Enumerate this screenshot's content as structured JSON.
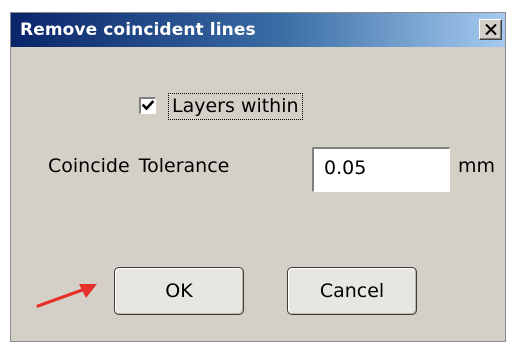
{
  "dialog": {
    "title": "Remove coincident lines",
    "close_glyph": "X",
    "layers_within": {
      "label": "Layers within",
      "checked": true
    },
    "tolerance": {
      "label": "Coincide Tolerance",
      "value": "0.05",
      "unit": "mm"
    },
    "buttons": {
      "ok_label": "OK",
      "cancel_label": "Cancel"
    }
  },
  "annotation": {
    "arrow_color": "#e8302a"
  },
  "colors": {
    "title_bar_start": "#0a246a",
    "title_bar_end": "#a6caf0",
    "dialog_face": "#d4d0c8"
  }
}
